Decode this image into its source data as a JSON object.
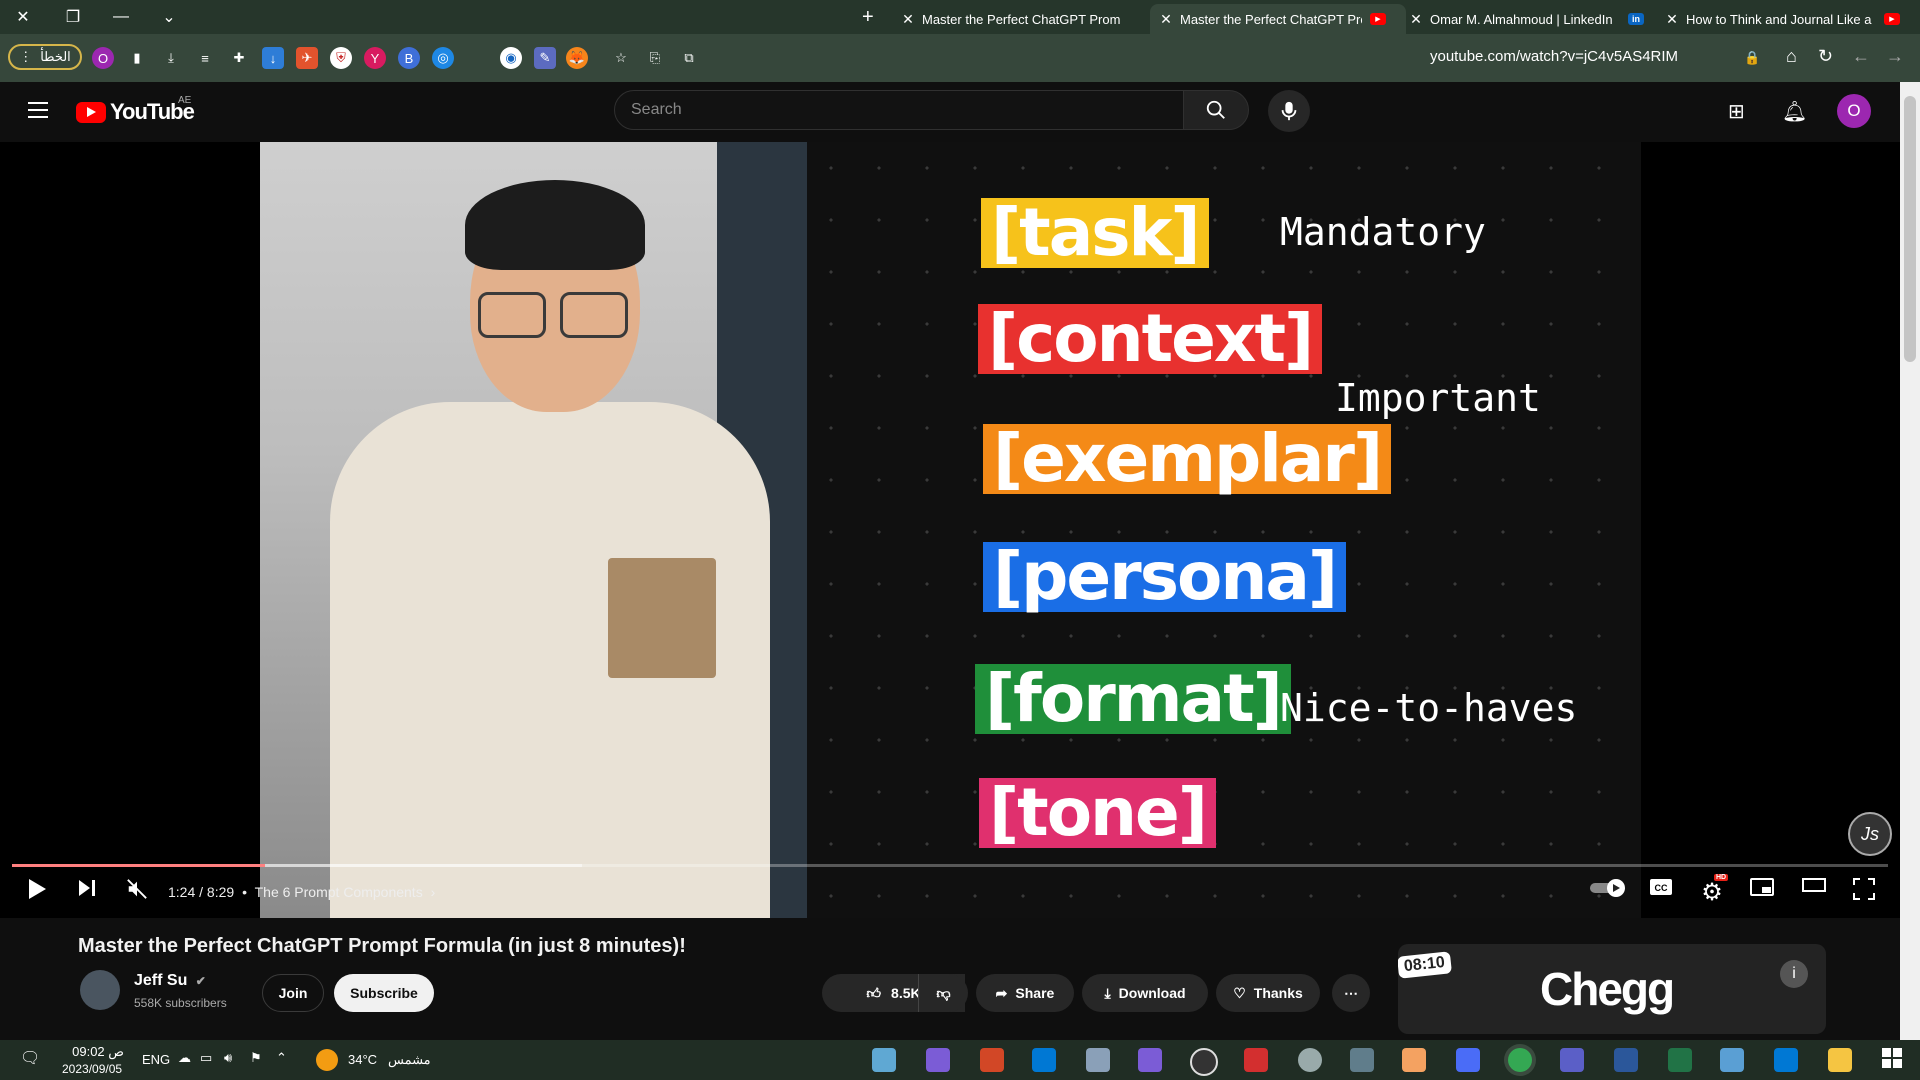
{
  "browser": {
    "error_pill": "الخطأ",
    "profile_letter": "O",
    "url": "youtube.com/watch?v=jC4v5AS4RIM",
    "tabs": [
      {
        "title": "Master the Perfect ChatGPT Prom"
      },
      {
        "title": "Master the Perfect ChatGPT Prom"
      },
      {
        "title": "Omar M. Almahmoud | LinkedIn"
      },
      {
        "title": "How to Think and Journal Like a"
      }
    ]
  },
  "youtube": {
    "logo_text": "YouTube",
    "country_code": "AE",
    "search_placeholder": "Search",
    "avatar_letter": "O"
  },
  "video": {
    "slide_tags": [
      "[task]",
      "[context]",
      "[exemplar]",
      "[persona]",
      "[format]",
      "[tone]"
    ],
    "slide_tag_colors": [
      "#f6c21b",
      "#e8312f",
      "#f48a17",
      "#1a6ee6",
      "#1f8f3a",
      "#e0306e"
    ],
    "slide_notes": [
      "Mandatory",
      "Important",
      "Nice-to-haves"
    ],
    "time": "1:24 / 8:29",
    "chapter": "The 6 Prompt Components",
    "progress_fraction": 0.135,
    "hd_badge": "HD"
  },
  "details": {
    "title": "Master the Perfect ChatGPT Prompt Formula (in just 8 minutes)!",
    "channel_name": "Jeff Su",
    "subscribers": "558K subscribers",
    "join_label": "Join",
    "subscribe_label": "Subscribe",
    "likes": "8.5K",
    "share_label": "Share",
    "download_label": "Download",
    "thanks_label": "Thanks"
  },
  "ad": {
    "brand": "Chegg",
    "time_badge": "08:10"
  },
  "taskbar": {
    "time": "09:02 ص",
    "date": "2023/09/05",
    "language": "ENG",
    "temperature": "34°C",
    "weather": "مشمس"
  }
}
